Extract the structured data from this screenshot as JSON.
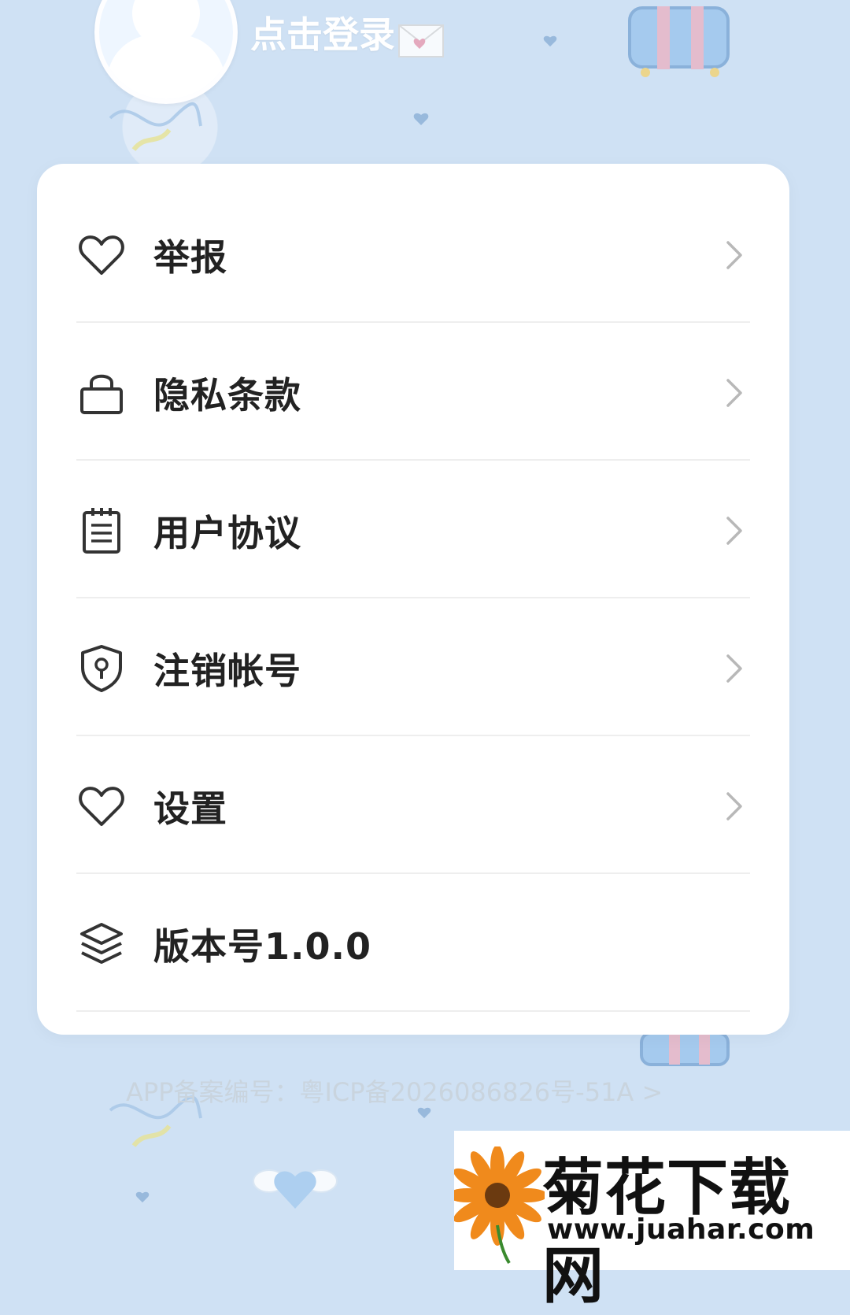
{
  "header": {
    "login_text": "点击登录"
  },
  "menu": {
    "items": [
      {
        "label": "举报",
        "icon": "heart-icon",
        "has_chevron": true
      },
      {
        "label": "隐私条款",
        "icon": "lock-icon",
        "has_chevron": true
      },
      {
        "label": "用户协议",
        "icon": "notepad-icon",
        "has_chevron": true
      },
      {
        "label": "注销帐号",
        "icon": "shield-keyhole-icon",
        "has_chevron": true
      },
      {
        "label": "设置",
        "icon": "heart-icon",
        "has_chevron": true
      },
      {
        "label": "版本号1.0.0",
        "icon": "layers-icon",
        "has_chevron": false
      }
    ]
  },
  "footer": {
    "icp_text": "APP备案编号：粤ICP备2026086826号-51A >"
  },
  "watermark": {
    "title": "菊花下载网",
    "url": "www.juahar.com"
  },
  "colors": {
    "background": "#cfe1f4",
    "card": "#ffffff",
    "text": "#222222",
    "chevron": "#b8b8b8",
    "divider": "#eeeeee"
  }
}
